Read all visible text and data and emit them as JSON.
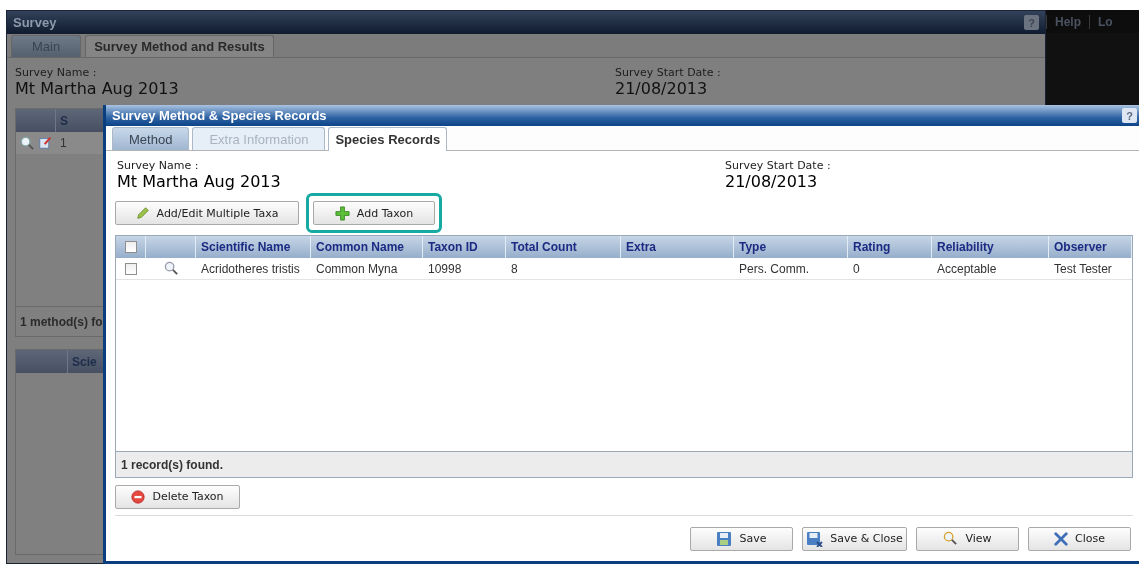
{
  "background_window": {
    "title": "Survey",
    "help": "?",
    "tabs": [
      {
        "label": "Main",
        "selected": false
      },
      {
        "label": "Survey Method and Results",
        "selected": true
      }
    ],
    "fields": [
      {
        "label": "Survey Name :",
        "value": "Mt Martha Aug 2013"
      },
      {
        "label": "Survey Start Date :",
        "value": "21/08/2013"
      }
    ],
    "methods_table": {
      "columns": [
        "S"
      ],
      "rows": [
        [
          "1"
        ]
      ],
      "footer": "1 method(s) fo"
    },
    "species_table": {
      "columns": [
        "Scie"
      ]
    }
  },
  "header_links": [
    "Help",
    "Lo"
  ],
  "dialog": {
    "title": "Survey Method & Species Records",
    "help": "?",
    "tabs": [
      {
        "label": "Method",
        "selected": false,
        "disabled": false
      },
      {
        "label": "Extra Information",
        "selected": false,
        "disabled": true
      },
      {
        "label": "Species Records",
        "selected": true,
        "disabled": false
      }
    ],
    "fields": [
      {
        "label": "Survey Name :",
        "value": "Mt Martha Aug 2013"
      },
      {
        "label": "Survey Start Date :",
        "value": "21/08/2013"
      }
    ],
    "toolbar": [
      {
        "label": "Add/Edit Multiple Taxa",
        "kind": "pencil",
        "highlighted": false
      },
      {
        "label": "Add Taxon",
        "kind": "add",
        "highlighted": true
      }
    ],
    "table": {
      "header_checked": false,
      "columns": [
        "Scientific Name",
        "Common Name",
        "Taxon ID",
        "Total Count",
        "Extra",
        "Type",
        "Rating",
        "Reliability",
        "Observer"
      ],
      "rows": [
        {
          "checked": false,
          "cells": [
            "Acridotheres tristis",
            "Common Myna",
            "10998",
            "8",
            null,
            "Pers. Comm.",
            "0",
            "Acceptable",
            "Test Tester"
          ]
        }
      ],
      "footer": "1 record(s) found."
    },
    "delete_button": "Delete Taxon",
    "buttons": [
      {
        "label": "Save",
        "kind": "save"
      },
      {
        "label": "Save & Close",
        "kind": "save-close"
      },
      {
        "label": "View",
        "kind": "view"
      },
      {
        "label": "Close",
        "kind": "close"
      }
    ]
  }
}
